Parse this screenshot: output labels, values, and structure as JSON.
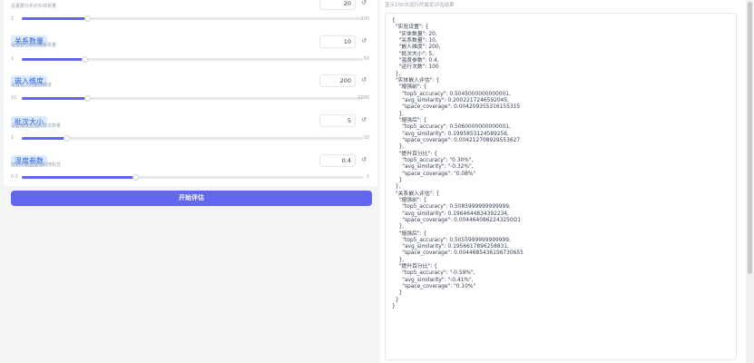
{
  "sliders": [
    {
      "label": "",
      "info": "设置要分析的实体数量",
      "value": "20",
      "min": "1",
      "max": "100",
      "fraction": 0.192
    },
    {
      "label": "关系数量",
      "info": "设置要分析的关系数量",
      "value": "10",
      "min": "1",
      "max": "50",
      "fraction": 0.184
    },
    {
      "label": "嵌入维度",
      "info": "设置嵌入向量的维度",
      "value": "200",
      "min": "10",
      "max": "1000",
      "fraction": 0.192
    },
    {
      "label": "批次大小",
      "info": "设置每批处理的样本数量",
      "value": "5",
      "min": "1",
      "max": "32",
      "fraction": 0.129
    },
    {
      "label": "温度参数",
      "info": "控制大模型翻译的随机性",
      "value": "0.4",
      "min": "0.1",
      "max": "1",
      "fraction": 0.333
    }
  ],
  "run_button": "开始评估",
  "output": {
    "info": "显示100次运行的最优评估结果",
    "text": "{\n  \"实验设置\": {\n    \"实体数量\": 20,\n    \"关系数量\": 10,\n    \"嵌入维度\": 200,\n    \"批次大小\": 5,\n    \"温度参数\": 0.4,\n    \"运行次数\": 100\n  },\n  \"实体嵌入评估\": {\n    \"增强前\": {\n      \"top5_accuracy\": 0.5045000000000001,\n      \"avg_similarity\": 0.2002217246592045,\n      \"space_coverage\": 0.004209355316155315\n    },\n    \"增强后\": {\n      \"top5_accuracy\": 0.5060000000000001,\n      \"avg_similarity\": 0.1995853124589256,\n      \"space_coverage\": 0.004212708929553627\n    },\n    \"提升百分比\": {\n      \"top5_accuracy\": \"0.30%\",\n      \"avg_similarity\": \"-0.32%\",\n      \"space_coverage\": \"0.08%\"\n    }\n  },\n  \"关系嵌入评估\": {\n    \"增强前\": {\n      \"top5_accuracy\": 0.5085999999999999,\n      \"avg_similarity\": 0.1964644834392234,\n      \"space_coverage\": 0.0044640862243250O1\n    },\n    \"增强后\": {\n      \"top5_accuracy\": 0.5055999999999999,\n      \"avg_similarity\": 0.1956617896258831,\n      \"space_coverage\": 0.0044685436156730655\n    },\n    \"提升百分比\": {\n      \"top5_accuracy\": \"-0.59%\",\n      \"avg_similarity\": \"-0.41%\",\n      \"space_coverage\": \"0.10%\"\n    }\n  }\n}"
  }
}
